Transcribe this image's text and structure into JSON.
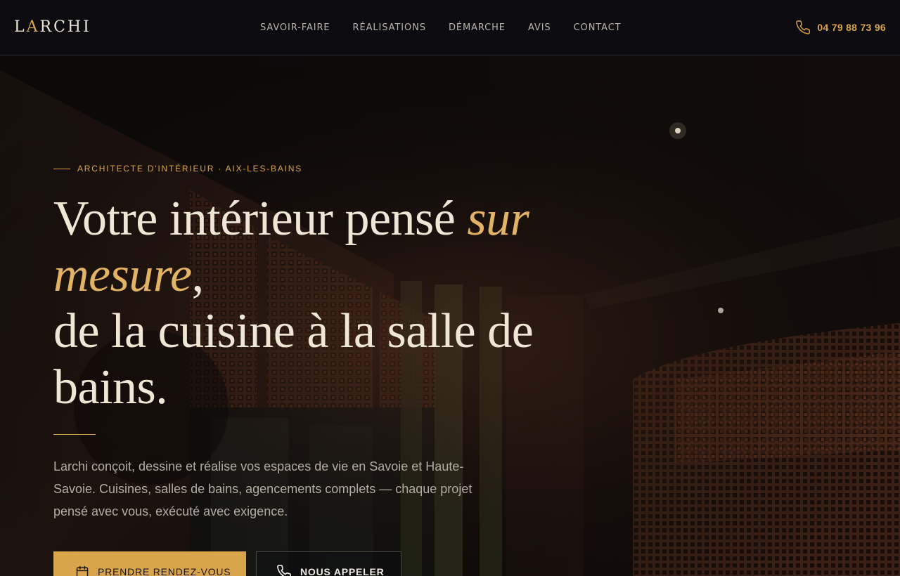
{
  "header": {
    "logo": {
      "pre": "L",
      "accent": "A",
      "post": "RCHI"
    },
    "nav": [
      "SAVOIR-FAIRE",
      "RÉALISATIONS",
      "DÉMARCHE",
      "AVIS",
      "CONTACT"
    ],
    "phone": "04 79 88 73 96",
    "phone_icon": "phone-icon"
  },
  "hero": {
    "eyebrow": "ARCHITECTE D'INTÉRIEUR · AIX-LES-BAINS",
    "headline": {
      "part1": "Votre intérieur pensé ",
      "accent": "sur mesure",
      "part2": ",",
      "part3": "de la cuisine à la salle de bains."
    },
    "lead": "Larchi conçoit, dessine et réalise vos espaces de vie en Savoie et Haute-Savoie. Cuisines, salles de bains, agencements complets — chaque projet pensé avec vous, exécuté avec exigence.",
    "primary_button": "PRENDRE RENDEZ-VOUS",
    "secondary_button": "NOUS APPELER",
    "primary_icon": "calendar-icon",
    "secondary_icon": "phone-icon"
  },
  "colors": {
    "background": "#0c0b10",
    "accent": "#d9a54c",
    "text_light": "#efe6d6",
    "text_muted": "#b3aca1"
  }
}
